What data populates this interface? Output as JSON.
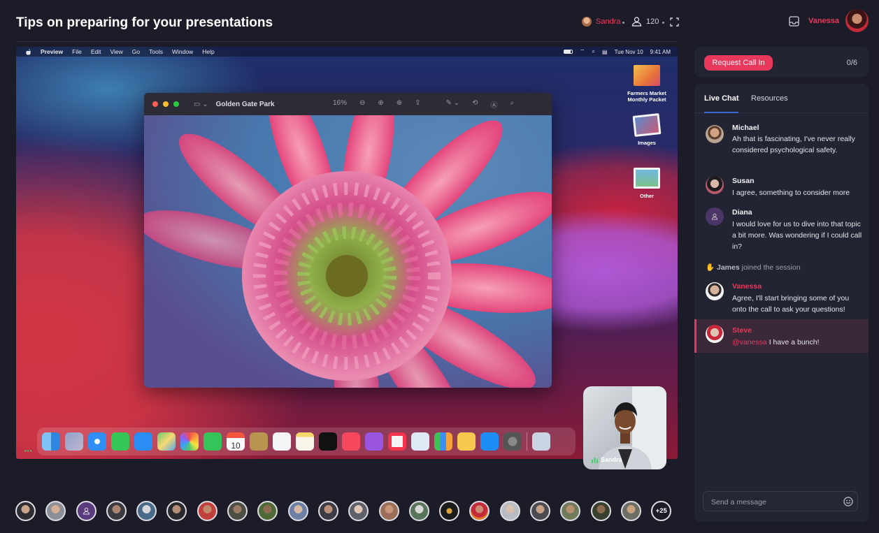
{
  "header": {
    "title": "Tips on preparing for your presentations",
    "presenter": "Sandra",
    "viewer_count": "120",
    "user_name": "Vanessa"
  },
  "screen": {
    "menubar": {
      "app": "Preview",
      "items": [
        "File",
        "Edit",
        "View",
        "Go",
        "Tools",
        "Window",
        "Help"
      ],
      "date": "Tue Nov 10",
      "time": "9:41 AM"
    },
    "window": {
      "title": "Golden Gate Park",
      "zoom": "16%"
    },
    "desktop_icons": [
      {
        "label": "Farmers Market Monthly Packet"
      },
      {
        "label": "Images"
      },
      {
        "label": "Other"
      }
    ],
    "calendar_day": "10"
  },
  "video": {
    "name": "Sandra"
  },
  "call_in": {
    "button_label": "Request Call In",
    "count": "0/6"
  },
  "chat": {
    "tabs": [
      "Live Chat",
      "Resources"
    ],
    "messages": [
      {
        "name": "Michael",
        "text": "Ah that is fascinating, I've never really considered psychological safety."
      },
      {
        "name": "Susan",
        "text": "I agree, something to consider more"
      },
      {
        "name": "Diana",
        "text": "I would love for us to dive into that topic a bit more. Was wondering if I could call in?"
      }
    ],
    "join_notice": {
      "name": "James",
      "text": "joined the session"
    },
    "vanessa_message": {
      "name": "Vanessa",
      "text": "Agree, I'll start bringing some of you onto the call to ask your questions!"
    },
    "steve_message": {
      "name": "Steve",
      "mention": "@vanessa",
      "text": "I have a bunch!"
    },
    "input_placeholder": "Send a message"
  },
  "participants": {
    "more_label": "+25"
  },
  "colors": {
    "accent": "#e8395c",
    "background": "#1c1c29",
    "panel": "#232433"
  }
}
